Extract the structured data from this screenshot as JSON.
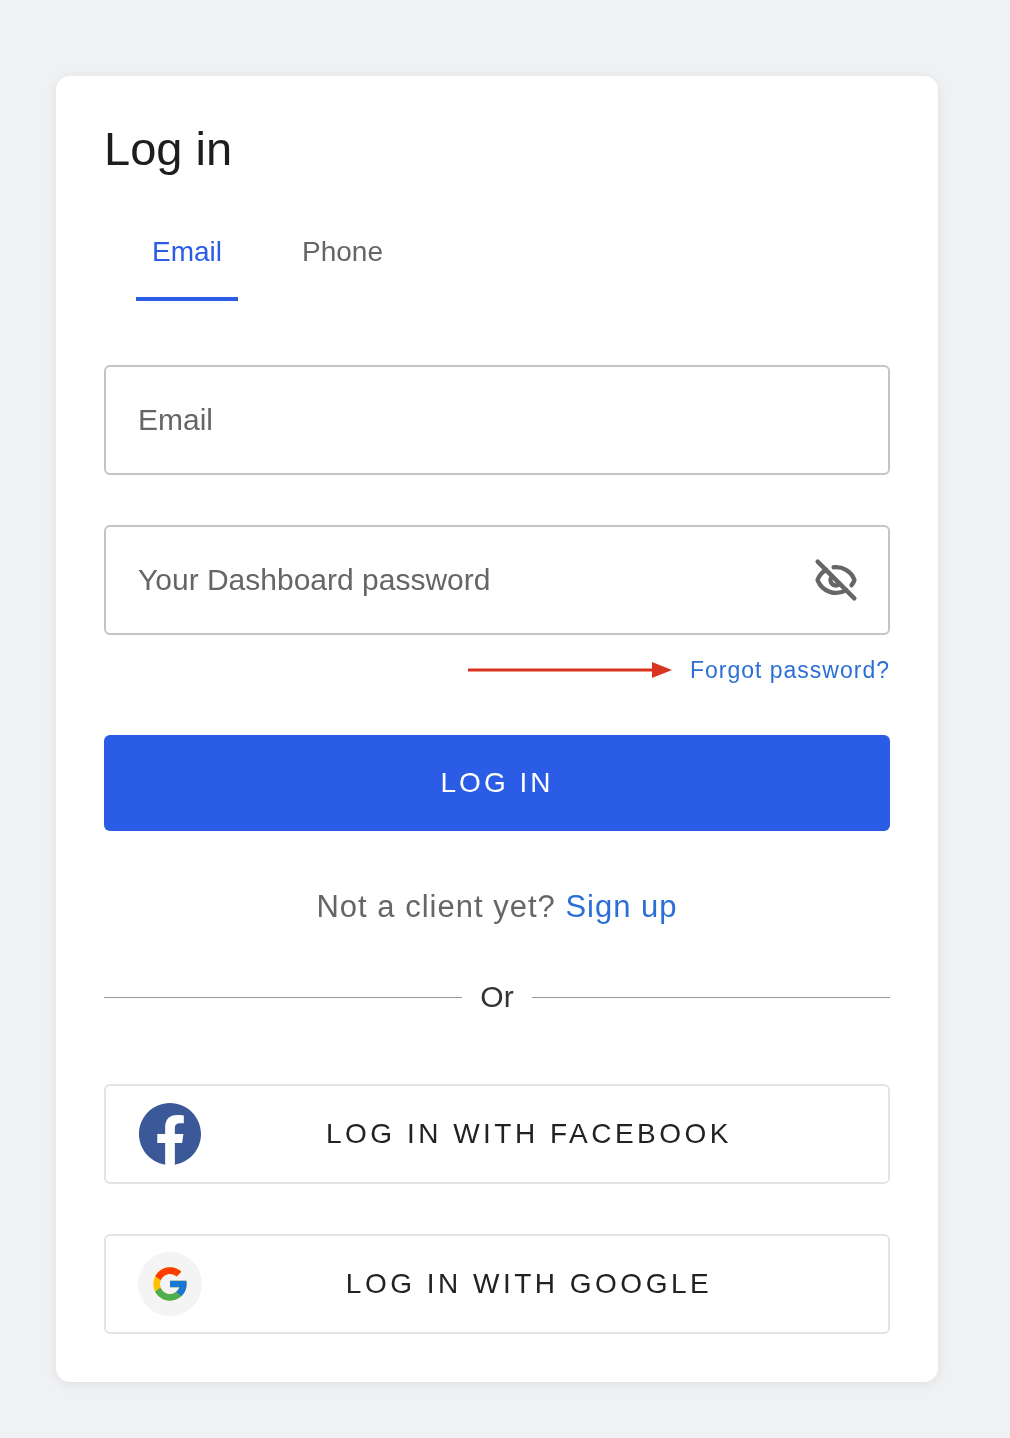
{
  "title": "Log in",
  "tabs": [
    {
      "label": "Email",
      "selected": true
    },
    {
      "label": "Phone",
      "selected": false
    }
  ],
  "fields": [
    {
      "kind": "text",
      "placeholder": "Email"
    },
    {
      "kind": "password",
      "placeholder": "Your Dashboard password"
    }
  ],
  "forgot_link": "Forgot password?",
  "login_button": "LOG IN",
  "signup": {
    "text": "Not a client yet?",
    "link": "Sign up"
  },
  "divider": "Or",
  "social_buttons": [
    {
      "kind": "facebook",
      "label": "LOG IN WITH FACEBOOK"
    },
    {
      "kind": "google",
      "label": "LOG IN WITH GOOGLE"
    }
  ]
}
